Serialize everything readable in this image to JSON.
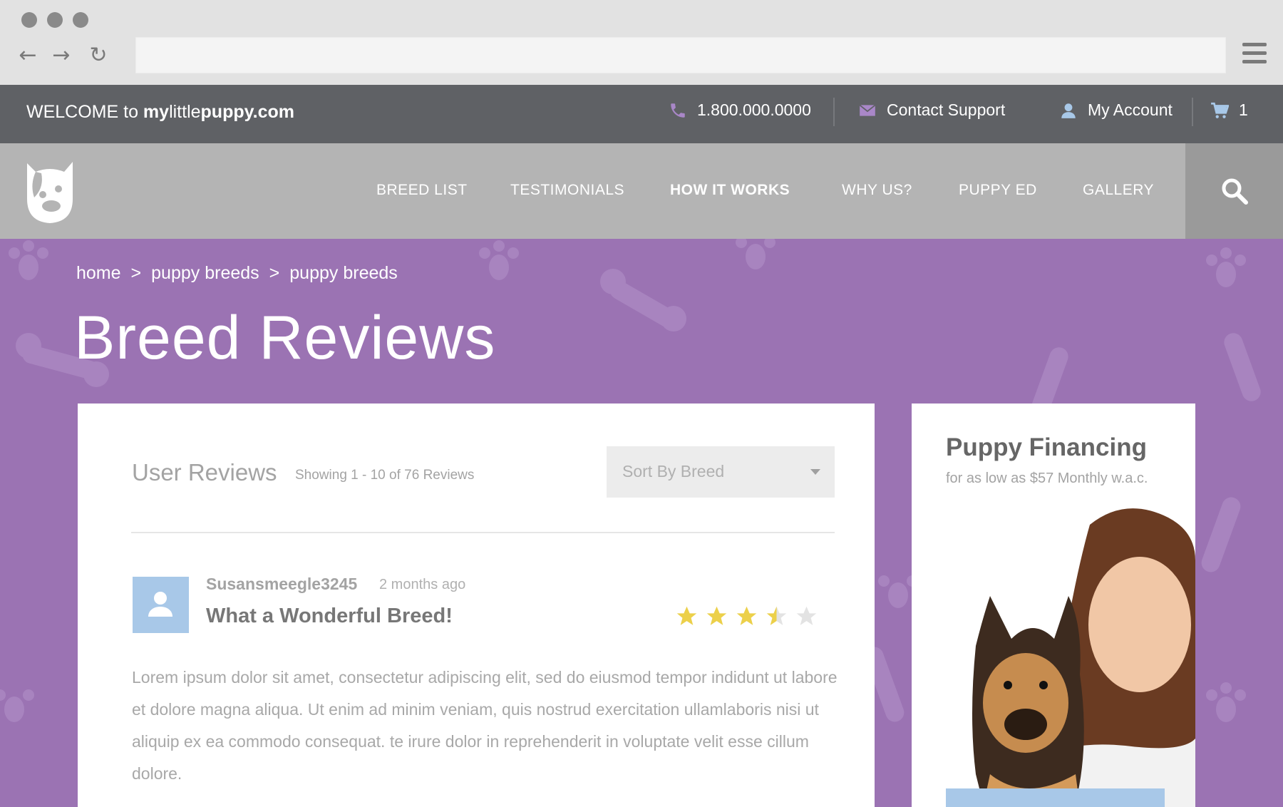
{
  "browser": {
    "address": ""
  },
  "topbar": {
    "welcome_prefix": "WELCOME to ",
    "welcome_my": "my",
    "welcome_little": "little",
    "welcome_puppy": "puppy.com",
    "phone": "1.800.000.0000",
    "contact": "Contact Support",
    "account": "My Account",
    "cart_count": "1"
  },
  "nav": {
    "items": [
      {
        "label": "BREED LIST"
      },
      {
        "label": "TESTIMONIALS"
      },
      {
        "label": "HOW IT WORKS",
        "active": true
      },
      {
        "label": "WHY US?"
      },
      {
        "label": "PUPPY ED"
      },
      {
        "label": "GALLERY"
      }
    ]
  },
  "breadcrumb": {
    "items": [
      "home",
      "puppy breeds",
      "puppy breeds"
    ],
    "separator": ">"
  },
  "page": {
    "title": "Breed Reviews"
  },
  "reviews": {
    "title": "User Reviews",
    "showing": "Showing 1 - 10 of 76 Reviews",
    "sort_label": "Sort By Breed",
    "items": [
      {
        "user": "Susansmeegle3245",
        "time": "2 months ago",
        "headline": "What a Wonderful Breed!",
        "rating": 3.5,
        "rating_max": 5,
        "body": "Lorem ipsum dolor sit amet, consectetur adipiscing elit, sed do eiusmod tempor indidunt ut labore et dolore magna aliqua. Ut enim ad minim veniam, quis nostrud exercitation ullamlaboris nisi ut aliquip ex ea commodo consequat. te irure dolor in reprehenderit in voluptate velit esse cillum dolore."
      }
    ]
  },
  "financing": {
    "title": "Puppy Financing",
    "subtitle": "for as low as $57 Monthly w.a.c."
  },
  "colors": {
    "brand_purple": "#9b73b3",
    "topbar": "#5f6165",
    "nav": "#b4b4b4",
    "star": "#ecd04a",
    "avatar": "#a8c8e8",
    "icon_accent": "#a987c8"
  }
}
